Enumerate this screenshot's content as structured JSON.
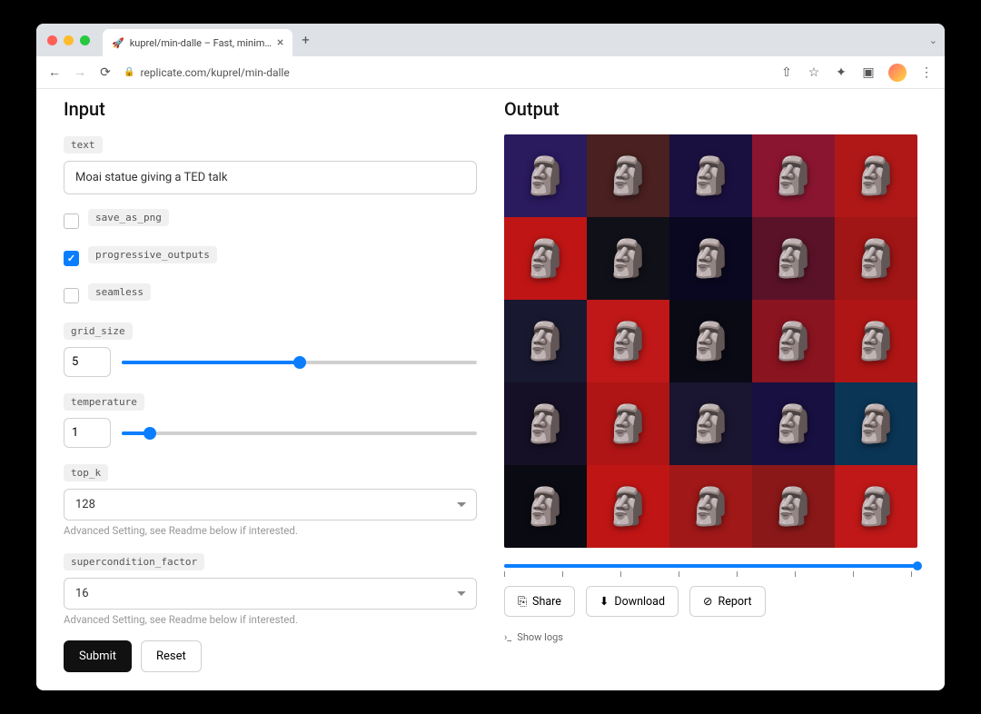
{
  "browser": {
    "tab_title": "kuprel/min-dalle – Fast, minim…",
    "url": "replicate.com/kuprel/min-dalle"
  },
  "input": {
    "heading": "Input",
    "text_label": "text",
    "text_value": "Moai statue giving a TED talk",
    "save_as_png_label": "save_as_png",
    "save_as_png": false,
    "progressive_outputs_label": "progressive_outputs",
    "progressive_outputs": true,
    "seamless_label": "seamless",
    "seamless": false,
    "grid_size_label": "grid_size",
    "grid_size": "5",
    "grid_size_pct": 50,
    "temperature_label": "temperature",
    "temperature": "1",
    "temperature_pct": 8,
    "top_k_label": "top_k",
    "top_k": "128",
    "top_k_help": "Advanced Setting, see Readme below if interested.",
    "supercondition_label": "supercondition_factor",
    "supercondition": "16",
    "supercondition_help": "Advanced Setting, see Readme below if interested.",
    "submit": "Submit",
    "reset": "Reset"
  },
  "output": {
    "heading": "Output",
    "share": "Share",
    "download": "Download",
    "report": "Report",
    "show_logs": "Show logs",
    "grid_cells": [
      "#2a1a5e",
      "#4a2020",
      "#1a1040",
      "#8a1530",
      "#b01818",
      "#c01515",
      "#101018",
      "#0a0820",
      "#5a1228",
      "#a01515",
      "#181830",
      "#c01818",
      "#0a0a15",
      "#8a1420",
      "#b01515",
      "#151025",
      "#b01515",
      "#1a1530",
      "#181040",
      "#0a3555",
      "#0a0a12",
      "#c01515",
      "#a01818",
      "#8a1818",
      "#c01818"
    ]
  }
}
